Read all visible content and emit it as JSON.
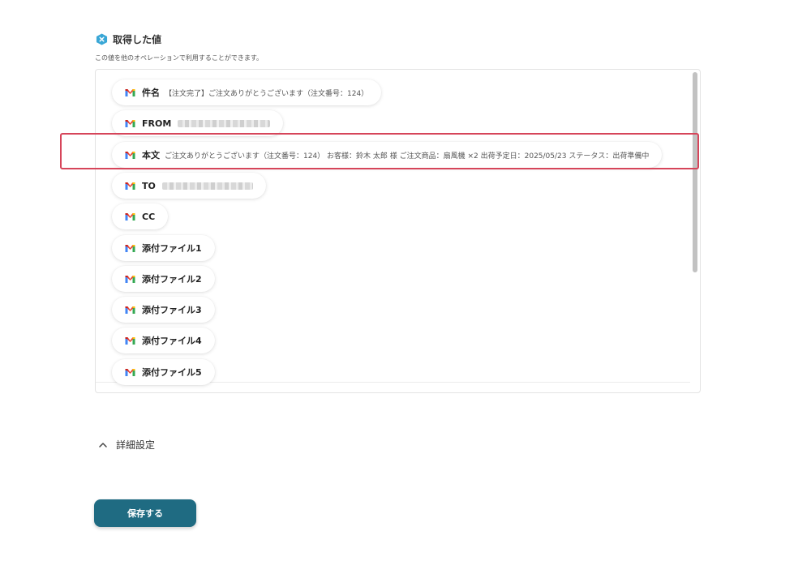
{
  "section": {
    "title": "取得した値",
    "description": "この値を他のオペレーションで利用することができます。",
    "icon": "hexagon-x-icon",
    "icon_color": "#3aa7d6"
  },
  "fields": [
    {
      "label": "件名",
      "value": "【注文完了】ご注文ありがとうございます（注文番号：124）",
      "icon": "gmail-icon"
    },
    {
      "label": "FROM",
      "value": "",
      "masked": true,
      "icon": "gmail-icon"
    },
    {
      "label": "本文",
      "value": "ご注文ありがとうございます（注文番号：124） お客様：鈴木 太郎 様 ご注文商品：扇風機 ×2 出荷予定日：2025/05/23 ステータス：出荷準備中",
      "icon": "gmail-icon",
      "highlighted": true
    },
    {
      "label": "TO",
      "value": "",
      "masked": true,
      "icon": "gmail-icon"
    },
    {
      "label": "CC",
      "value": "",
      "icon": "gmail-icon"
    },
    {
      "label": "添付ファイル1",
      "value": "",
      "icon": "gmail-icon"
    },
    {
      "label": "添付ファイル2",
      "value": "",
      "icon": "gmail-icon"
    },
    {
      "label": "添付ファイル3",
      "value": "",
      "icon": "gmail-icon"
    },
    {
      "label": "添付ファイル4",
      "value": "",
      "icon": "gmail-icon"
    },
    {
      "label": "添付ファイル5",
      "value": "",
      "icon": "gmail-icon"
    }
  ],
  "details": {
    "label": "詳細設定",
    "icon": "chevron-up-icon"
  },
  "save_button": {
    "label": "保存する",
    "color": "#1f6b82"
  },
  "highlight_color": "#d6455a"
}
